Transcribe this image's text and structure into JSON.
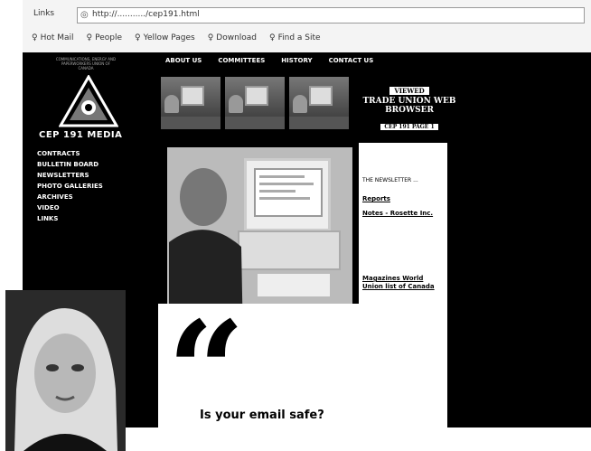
{
  "browser": {
    "address_label": "Links",
    "url": "http://.........../cep191.html",
    "links": [
      "Hot Mail",
      "People",
      "Yellow Pages",
      "Download",
      "Find a Site"
    ]
  },
  "site": {
    "logo_caption": "COMMUNICATIONS, ENERGY AND PAPERWORKERS UNION OF CANADA",
    "logo_name": "CEP 191 MEDIA",
    "top_nav": [
      "ABOUT US",
      "COMMITTEES",
      "HISTORY",
      "CONTACT US"
    ],
    "side_nav": [
      "CONTRACTS",
      "BULLETIN BOARD",
      "NEWSLETTERS",
      "PHOTO GALLERIES",
      "ARCHIVES",
      "VIDEO",
      "LINKS"
    ],
    "badge": {
      "top": "VIEWED",
      "middle": "TRADE UNION WEB BROWSER",
      "bottom": "CEP 191 PAGE 1"
    },
    "right_panel": {
      "intro": "THE NEWSLETTER ...",
      "links": [
        "Reports",
        "Notes - Rosette Inc.",
        "Magazines World Union list of Canada"
      ]
    },
    "tagline": "Is your email safe?",
    "quote_glyph": "“"
  },
  "colors": {
    "site_bg": "#000000",
    "panel_bg": "#ffffff",
    "chrome_bg": "#f4f4f4"
  }
}
